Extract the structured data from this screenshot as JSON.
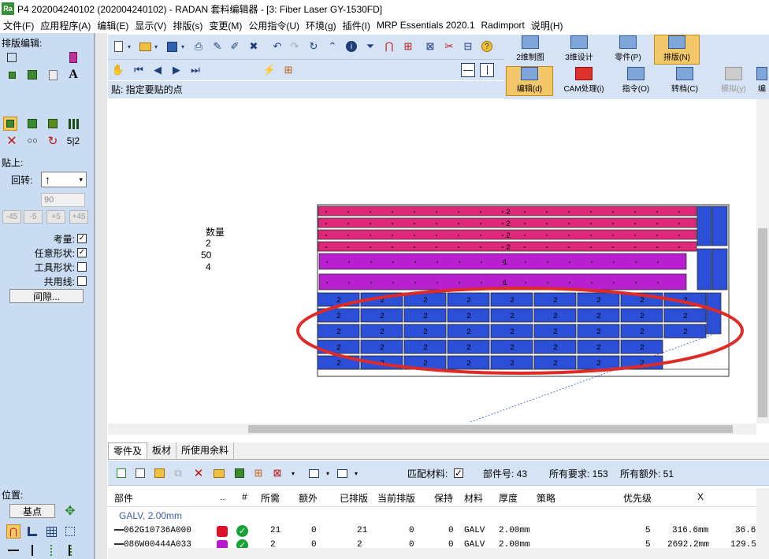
{
  "window": {
    "logo": "Ra",
    "title": "P4 202004240102 (202004240102) - RADAN 套料编辑器 - [3: Fiber Laser GY-1530FD]"
  },
  "menu": [
    "文件(F)",
    "应用程序(A)",
    "编辑(E)",
    "显示(V)",
    "排版(s)",
    "变更(M)",
    "公用指令(U)",
    "环境(g)",
    "插件(I)",
    "MRP Essentials 2020.1",
    "Radimport",
    "说明(H)"
  ],
  "left_panel": {
    "edit_title": "排版编辑:",
    "text_tool": "A",
    "ratio_tool": "5|2",
    "paste_title": "贴上:",
    "rotate_label": "回转:",
    "rotate_value": "↑",
    "angle_input": "90",
    "angle_buttons": [
      "-45",
      "-5",
      "+5",
      "+45"
    ],
    "options": [
      {
        "label": "考量:",
        "checked": true
      },
      {
        "label": "任意形状:",
        "checked": true
      },
      {
        "label": "工具形状:",
        "checked": false
      },
      {
        "label": "共用线:",
        "checked": false
      }
    ],
    "gap_button": "间隙...",
    "position_title": "位置:",
    "base_button": "基点"
  },
  "big_buttons": [
    {
      "label": "2维制图",
      "selected": false
    },
    {
      "label": "3维设计",
      "selected": false
    },
    {
      "label": "零件(P)",
      "selected": false
    },
    {
      "label": "排版(N)",
      "selected": true
    }
  ],
  "sub_buttons": [
    {
      "label": "编辑(d)",
      "selected": true
    },
    {
      "label": "CAM处理(i)",
      "selected": false
    },
    {
      "label": "指令(O)",
      "selected": false
    },
    {
      "label": "转档(C)",
      "selected": false
    },
    {
      "label": "模拟(y)",
      "selected": false
    },
    {
      "label": "编",
      "selected": false
    }
  ],
  "status_text": "贴:  指定要贴的点",
  "canvas": {
    "qty_header": "数量",
    "qty_values": [
      "2",
      "50",
      "4"
    ],
    "part_labels": [
      "2",
      "1"
    ]
  },
  "tabs": [
    "零件及",
    "板材",
    "所使用余料"
  ],
  "bottom_info": {
    "match_material_label": "匹配材料:",
    "match_material_checked": true,
    "part_count": "部件号: 43",
    "total_required": "所有要求: 153",
    "total_extra": "所有额外: 51"
  },
  "table": {
    "headers": [
      "部件",
      "..",
      "#",
      "所需",
      "额外",
      "已排版",
      "当前排版",
      "保持",
      "材料",
      "厚度",
      "策略",
      "优先级",
      "X"
    ],
    "group": "GALV, 2.00mm",
    "rows": [
      {
        "part": "062G10736A000",
        "color": "#e0102a",
        "required": "21",
        "extra": "0",
        "nested": "21",
        "current": "0",
        "hold": "0",
        "material": "GALV",
        "thickness": "2.00mm",
        "priority": "5",
        "x": "316.6mm",
        "y": "36.6"
      },
      {
        "part": "086W00444A033",
        "color": "#b818d0",
        "required": "2",
        "extra": "0",
        "nested": "2",
        "current": "0",
        "hold": "0",
        "material": "GALV",
        "thickness": "2.00mm",
        "priority": "5",
        "x": "2692.2mm",
        "y": "129.5"
      }
    ]
  },
  "colors": {
    "magenta": "#e0287a",
    "purple": "#b820cf",
    "blue": "#2c4fd8",
    "highlight": "#e02a28",
    "panel": "#c9dcf2",
    "toolbar": "#d5e3f5"
  }
}
